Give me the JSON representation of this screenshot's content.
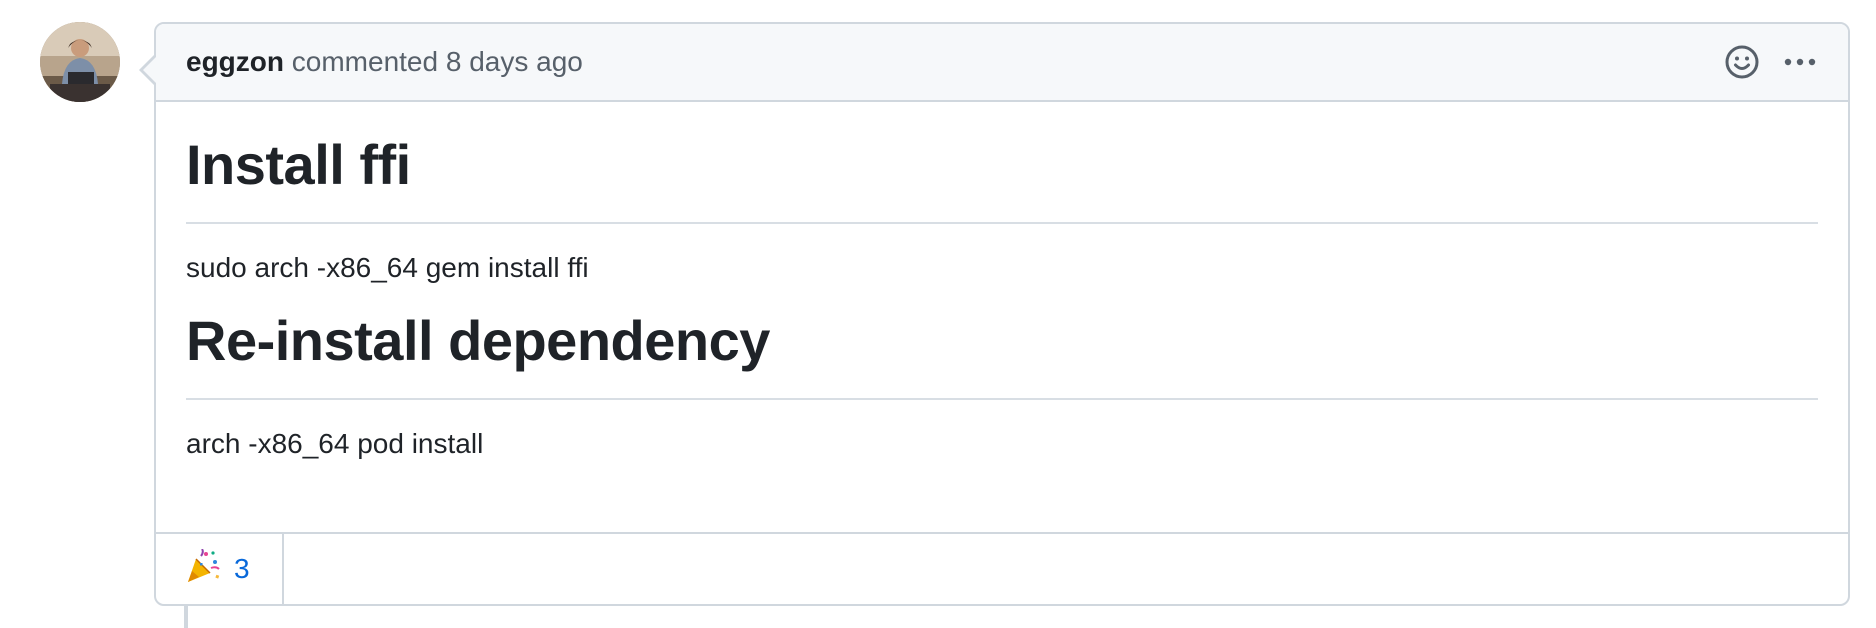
{
  "comment": {
    "author": "eggzon",
    "action": "commented",
    "timestamp": "8 days ago",
    "body": {
      "heading_1": "Install ffi",
      "paragraph_1": "sudo arch -x86_64 gem install ffi",
      "heading_2": "Re-install dependency",
      "paragraph_2": "arch -x86_64 pod install"
    },
    "header_icons": [
      "smiley-icon",
      "kebab-horizontal-icon"
    ],
    "reactions": [
      {
        "icon": "tada-icon",
        "count": "3"
      }
    ]
  },
  "colors": {
    "border": "#d0d7de",
    "header_bg": "#f6f8fa",
    "text": "#1f2328",
    "muted": "#57606a",
    "link": "#0969da"
  }
}
